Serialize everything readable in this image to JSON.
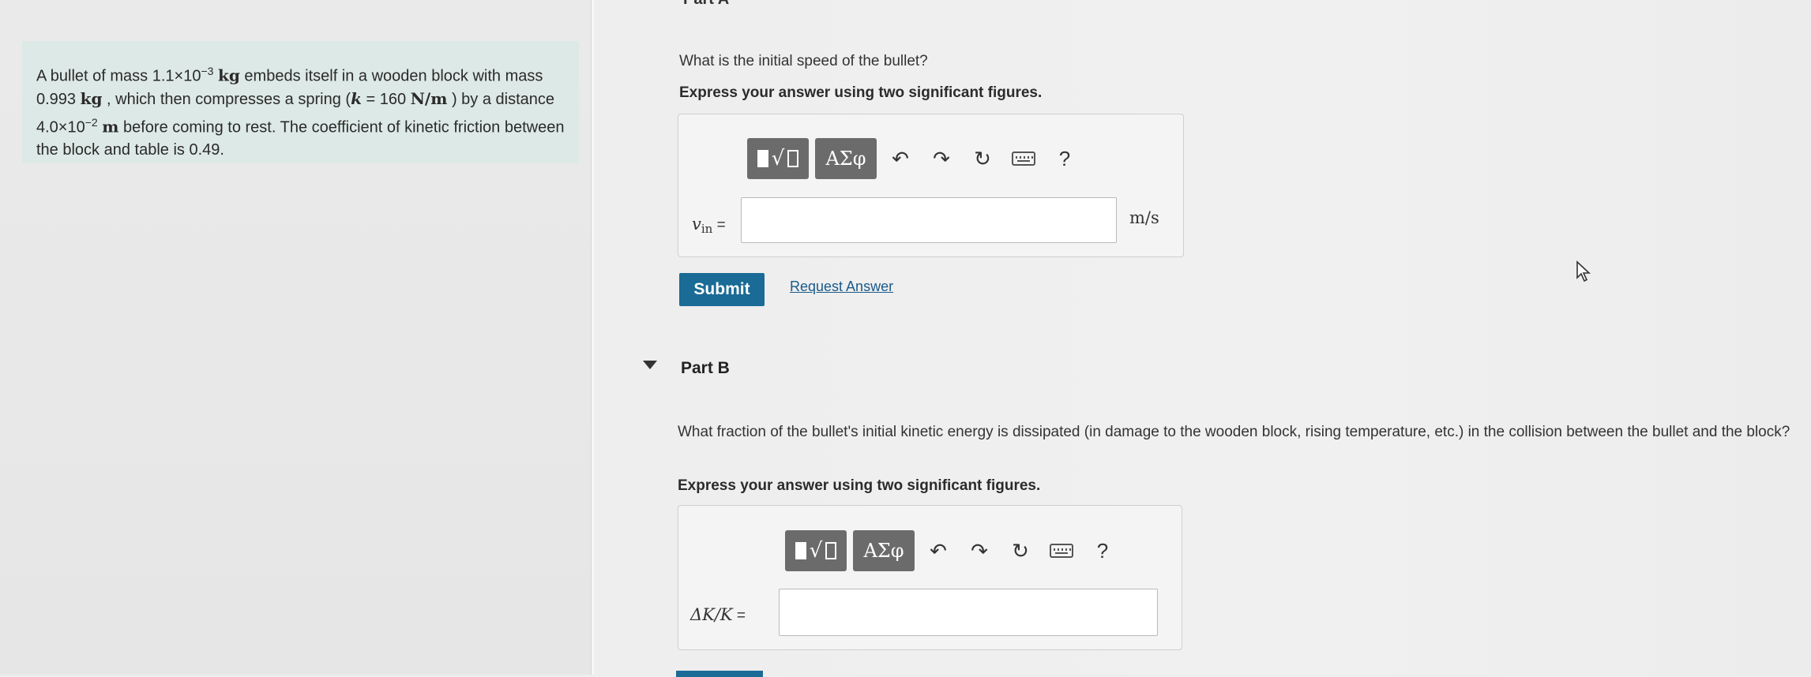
{
  "problem": {
    "t1": "A bullet of mass ",
    "mass_bullet_mantissa": "1.1×10",
    "mass_bullet_exp": "−3",
    "kg": "kg",
    "t2": " embeds itself in a wooden block with mass ",
    "mass_block": "0.993",
    "t3": " , which then compresses a spring (",
    "k_symbol": "k",
    "k_eq": " = 160 ",
    "k_unit": "N/m",
    "t4": " ) by a distance ",
    "dist_mantissa": "4.0×10",
    "dist_exp": "−2",
    "m_unit": "m",
    "t5": " before coming to rest. The coefficient of kinetic friction between the block and table is 0.49."
  },
  "partA": {
    "header": "Part A",
    "question": "What is the initial speed of the bullet?",
    "instruction": "Express your answer using two significant figures.",
    "toolbar": {
      "templates_icon": "templates-icon",
      "symbols_label": "ΑΣφ",
      "undo_icon": "undo-icon",
      "redo_icon": "redo-icon",
      "reset_icon": "reset-icon",
      "keyboard_icon": "keyboard-icon",
      "help_label": "?"
    },
    "var_main": "v",
    "var_sub": "in",
    "equals": " =",
    "input_value": "",
    "unit": "m/s",
    "submit_label": "Submit",
    "request_answer_label": "Request Answer"
  },
  "partB": {
    "title": "Part B",
    "question": "What fraction of the bullet's initial kinetic energy is dissipated (in damage to the wooden block, rising temperature, etc.) in the collision between the bullet and the block?",
    "instruction": "Express your answer using two significant figures.",
    "toolbar": {
      "symbols_label": "ΑΣφ",
      "help_label": "?"
    },
    "var_label": "ΔK/K",
    "equals": " =",
    "input_value": ""
  },
  "colors": {
    "problem_bg": "#dde9e6",
    "submit_bg": "#1a6b96",
    "toolbar_btn": "#6b6b6b",
    "link": "#1a5a8a"
  }
}
